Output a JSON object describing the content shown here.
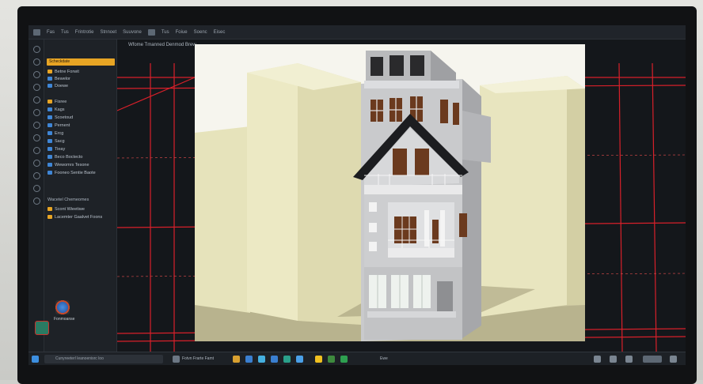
{
  "topbar": {
    "items": [
      "Fas",
      "Tus",
      "Frintrotie",
      "Stnnoet",
      "Suuvone",
      "Tus",
      "Foiue",
      "Soenc",
      "Eisec"
    ]
  },
  "panel": {
    "search_value": "Scheckdate",
    "items": [
      {
        "label": "Betne Forwit"
      },
      {
        "label": "Bewelor"
      },
      {
        "label": "Doewe"
      },
      {
        "label": "Fisree"
      },
      {
        "label": "Kags"
      },
      {
        "label": "Scoetoud"
      },
      {
        "label": "Pernent"
      },
      {
        "label": "Ercg"
      },
      {
        "label": "Sacg"
      },
      {
        "label": "Tieay"
      },
      {
        "label": "Beco Boctecto"
      },
      {
        "label": "Wewomrs Tesone"
      },
      {
        "label": "Fooneo Sentie Baote"
      }
    ],
    "section_title": "Wacetel Chemeomes",
    "section_items": [
      "Scont Wieetiwe",
      "Lacemter Gaalvet Foons"
    ]
  },
  "desktop": {
    "icon_label": "Fonmoanse"
  },
  "canvas": {
    "doc_tab": "Wfome Tmanned Denmod Brew"
  },
  "taskbar": {
    "search_placeholder": "Cunyreeterl leanoenisrc loo",
    "app_label": "Fotvn Frarte Famt",
    "tray_text": "Ewe"
  },
  "colors": {
    "accent": "#e8a524",
    "cad_red": "#d8202a",
    "wall_tone": "#e7e4bf",
    "building_gray": "#c8c9cb"
  }
}
